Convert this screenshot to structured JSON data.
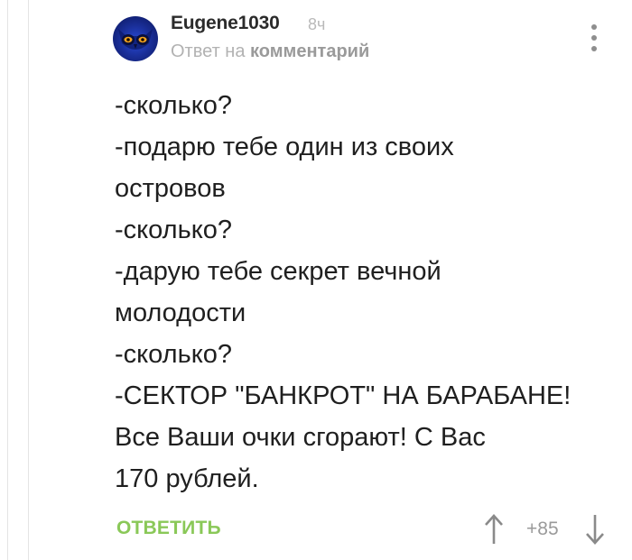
{
  "comment": {
    "author": "Eugene1030",
    "time": "8ч",
    "reply_prefix": "Ответ на",
    "reply_target": "комментарий",
    "lines": [
      "-сколько?",
      "-подарю тебе один из своих",
      "островов",
      "-сколько?",
      "-дарую тебе секрет вечной",
      "молодости",
      "-сколько?",
      "-СЕКТОР \"БАНКРОТ\" НА БАРАБАНЕ!",
      "Все Ваши очки сгорают! С Вас",
      "170 рублей."
    ],
    "reply_label": "ОТВЕТИТЬ",
    "rating": "+85"
  },
  "icons": {
    "avatar": "owl-avatar",
    "menu": "more-vertical-icon",
    "upvote": "arrow-up-icon",
    "downvote": "arrow-down-icon"
  },
  "colors": {
    "accent_green": "#8ac858",
    "muted_text": "#b2b2b2",
    "avatar_blue": "#1a2f9a"
  }
}
